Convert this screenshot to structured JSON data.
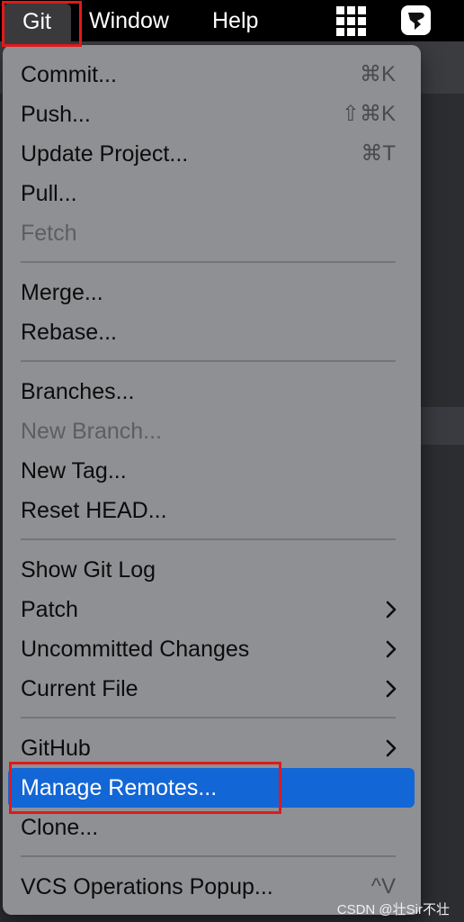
{
  "menubar": {
    "git_label": "Git",
    "window_label": "Window",
    "help_label": "Help",
    "grid_icon": "app-grid-icon",
    "app_icon": "bird-app-icon"
  },
  "menu": {
    "items": [
      {
        "label": "Commit...",
        "shortcut": "⌘K",
        "enabled": true
      },
      {
        "label": "Push...",
        "shortcut": "⇧⌘K",
        "enabled": true
      },
      {
        "label": "Update Project...",
        "shortcut": "⌘T",
        "enabled": true
      },
      {
        "label": "Pull...",
        "enabled": true
      },
      {
        "label": "Fetch",
        "enabled": false
      },
      {
        "label": "Merge...",
        "enabled": true
      },
      {
        "label": "Rebase...",
        "enabled": true
      },
      {
        "label": "Branches...",
        "enabled": true
      },
      {
        "label": "New Branch...",
        "enabled": false
      },
      {
        "label": "New Tag...",
        "enabled": true
      },
      {
        "label": "Reset HEAD...",
        "enabled": true
      },
      {
        "label": "Show Git Log",
        "enabled": true
      },
      {
        "label": "Patch",
        "submenu": true,
        "enabled": true
      },
      {
        "label": "Uncommitted Changes",
        "submenu": true,
        "enabled": true
      },
      {
        "label": "Current File",
        "submenu": true,
        "enabled": true
      },
      {
        "label": "GitHub",
        "submenu": true,
        "enabled": true
      },
      {
        "label": "Manage Remotes...",
        "selected": true,
        "enabled": true
      },
      {
        "label": "Clone...",
        "enabled": true
      },
      {
        "label": "VCS Operations Popup...",
        "shortcut": "^V",
        "enabled": true
      }
    ]
  },
  "colors": {
    "selection": "#1366d6",
    "annotation_box": "#e0191c",
    "menu_bg": "#8f9093"
  },
  "watermark": "CSDN @壮Sir不壮"
}
